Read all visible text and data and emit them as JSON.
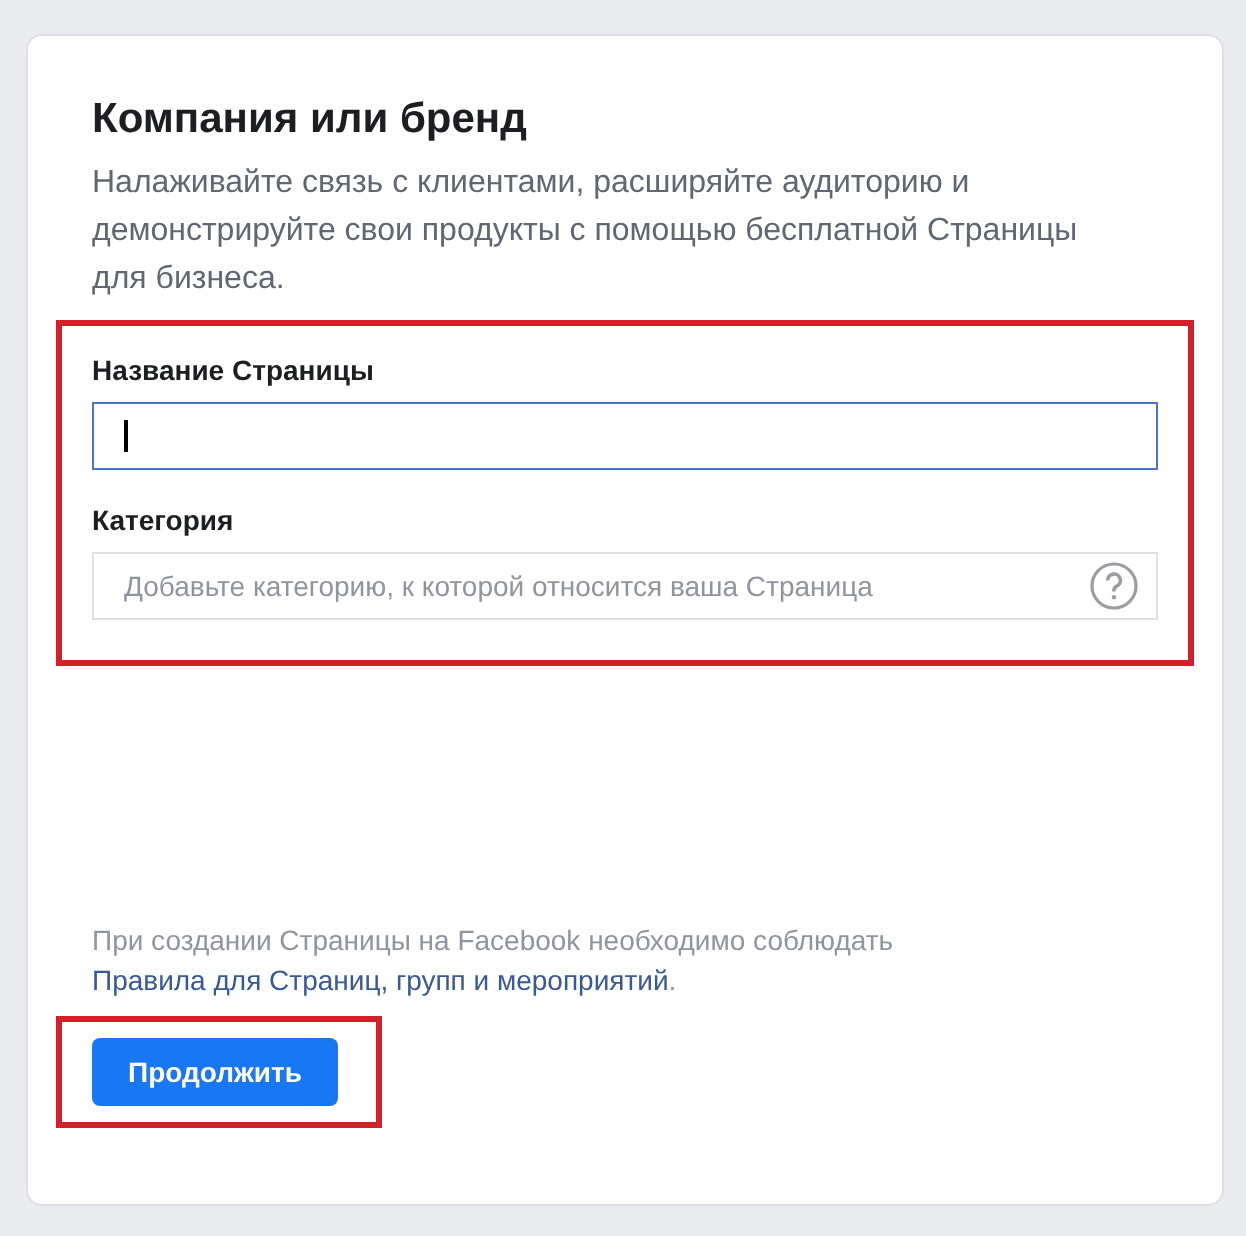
{
  "title": "Компания или бренд",
  "description": "Налаживайте связь с клиентами, расширяйте аудиторию и демонстрируйте свои продукты с помощью бесплатной Страницы для бизнеса.",
  "fields": [
    {
      "kind": "text",
      "label": "Название Страницы",
      "focused": true
    },
    {
      "kind": "help",
      "label": "Категория",
      "placeholder": "Добавьте категорию, к которой относится ваша Страница",
      "focused": false
    }
  ],
  "notice": {
    "text": "При создании Страницы на Facebook необходимо соблюдать",
    "link": "Правила для Страниц, групп и мероприятий",
    "end": "."
  },
  "button": "Продолжить"
}
